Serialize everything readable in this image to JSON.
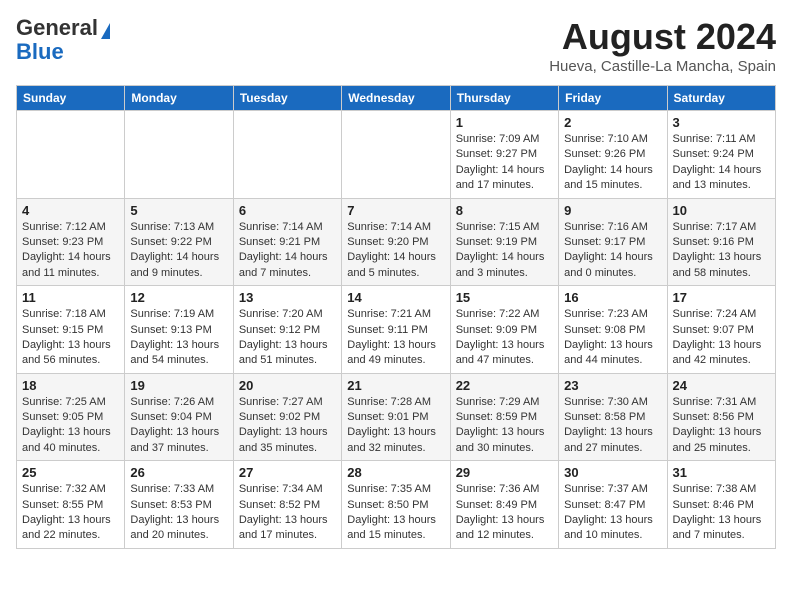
{
  "header": {
    "logo_general": "General",
    "logo_blue": "Blue",
    "month_year": "August 2024",
    "location": "Hueva, Castille-La Mancha, Spain"
  },
  "days_of_week": [
    "Sunday",
    "Monday",
    "Tuesday",
    "Wednesday",
    "Thursday",
    "Friday",
    "Saturday"
  ],
  "weeks": [
    [
      {
        "day": "",
        "info": ""
      },
      {
        "day": "",
        "info": ""
      },
      {
        "day": "",
        "info": ""
      },
      {
        "day": "",
        "info": ""
      },
      {
        "day": "1",
        "info": "Sunrise: 7:09 AM\nSunset: 9:27 PM\nDaylight: 14 hours and 17 minutes."
      },
      {
        "day": "2",
        "info": "Sunrise: 7:10 AM\nSunset: 9:26 PM\nDaylight: 14 hours and 15 minutes."
      },
      {
        "day": "3",
        "info": "Sunrise: 7:11 AM\nSunset: 9:24 PM\nDaylight: 14 hours and 13 minutes."
      }
    ],
    [
      {
        "day": "4",
        "info": "Sunrise: 7:12 AM\nSunset: 9:23 PM\nDaylight: 14 hours and 11 minutes."
      },
      {
        "day": "5",
        "info": "Sunrise: 7:13 AM\nSunset: 9:22 PM\nDaylight: 14 hours and 9 minutes."
      },
      {
        "day": "6",
        "info": "Sunrise: 7:14 AM\nSunset: 9:21 PM\nDaylight: 14 hours and 7 minutes."
      },
      {
        "day": "7",
        "info": "Sunrise: 7:14 AM\nSunset: 9:20 PM\nDaylight: 14 hours and 5 minutes."
      },
      {
        "day": "8",
        "info": "Sunrise: 7:15 AM\nSunset: 9:19 PM\nDaylight: 14 hours and 3 minutes."
      },
      {
        "day": "9",
        "info": "Sunrise: 7:16 AM\nSunset: 9:17 PM\nDaylight: 14 hours and 0 minutes."
      },
      {
        "day": "10",
        "info": "Sunrise: 7:17 AM\nSunset: 9:16 PM\nDaylight: 13 hours and 58 minutes."
      }
    ],
    [
      {
        "day": "11",
        "info": "Sunrise: 7:18 AM\nSunset: 9:15 PM\nDaylight: 13 hours and 56 minutes."
      },
      {
        "day": "12",
        "info": "Sunrise: 7:19 AM\nSunset: 9:13 PM\nDaylight: 13 hours and 54 minutes."
      },
      {
        "day": "13",
        "info": "Sunrise: 7:20 AM\nSunset: 9:12 PM\nDaylight: 13 hours and 51 minutes."
      },
      {
        "day": "14",
        "info": "Sunrise: 7:21 AM\nSunset: 9:11 PM\nDaylight: 13 hours and 49 minutes."
      },
      {
        "day": "15",
        "info": "Sunrise: 7:22 AM\nSunset: 9:09 PM\nDaylight: 13 hours and 47 minutes."
      },
      {
        "day": "16",
        "info": "Sunrise: 7:23 AM\nSunset: 9:08 PM\nDaylight: 13 hours and 44 minutes."
      },
      {
        "day": "17",
        "info": "Sunrise: 7:24 AM\nSunset: 9:07 PM\nDaylight: 13 hours and 42 minutes."
      }
    ],
    [
      {
        "day": "18",
        "info": "Sunrise: 7:25 AM\nSunset: 9:05 PM\nDaylight: 13 hours and 40 minutes."
      },
      {
        "day": "19",
        "info": "Sunrise: 7:26 AM\nSunset: 9:04 PM\nDaylight: 13 hours and 37 minutes."
      },
      {
        "day": "20",
        "info": "Sunrise: 7:27 AM\nSunset: 9:02 PM\nDaylight: 13 hours and 35 minutes."
      },
      {
        "day": "21",
        "info": "Sunrise: 7:28 AM\nSunset: 9:01 PM\nDaylight: 13 hours and 32 minutes."
      },
      {
        "day": "22",
        "info": "Sunrise: 7:29 AM\nSunset: 8:59 PM\nDaylight: 13 hours and 30 minutes."
      },
      {
        "day": "23",
        "info": "Sunrise: 7:30 AM\nSunset: 8:58 PM\nDaylight: 13 hours and 27 minutes."
      },
      {
        "day": "24",
        "info": "Sunrise: 7:31 AM\nSunset: 8:56 PM\nDaylight: 13 hours and 25 minutes."
      }
    ],
    [
      {
        "day": "25",
        "info": "Sunrise: 7:32 AM\nSunset: 8:55 PM\nDaylight: 13 hours and 22 minutes."
      },
      {
        "day": "26",
        "info": "Sunrise: 7:33 AM\nSunset: 8:53 PM\nDaylight: 13 hours and 20 minutes."
      },
      {
        "day": "27",
        "info": "Sunrise: 7:34 AM\nSunset: 8:52 PM\nDaylight: 13 hours and 17 minutes."
      },
      {
        "day": "28",
        "info": "Sunrise: 7:35 AM\nSunset: 8:50 PM\nDaylight: 13 hours and 15 minutes."
      },
      {
        "day": "29",
        "info": "Sunrise: 7:36 AM\nSunset: 8:49 PM\nDaylight: 13 hours and 12 minutes."
      },
      {
        "day": "30",
        "info": "Sunrise: 7:37 AM\nSunset: 8:47 PM\nDaylight: 13 hours and 10 minutes."
      },
      {
        "day": "31",
        "info": "Sunrise: 7:38 AM\nSunset: 8:46 PM\nDaylight: 13 hours and 7 minutes."
      }
    ]
  ]
}
